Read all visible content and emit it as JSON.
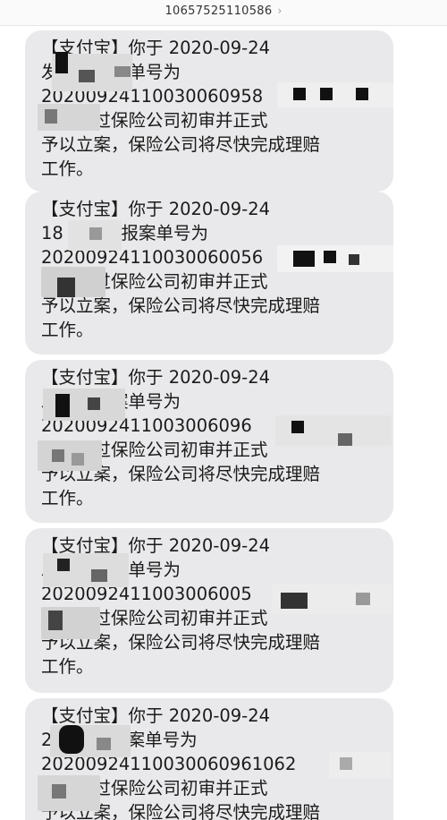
{
  "header": {
    "contact_number": "10657525110586",
    "chevron_icon": "chevron-right-icon"
  },
  "messages": [
    {
      "lines": [
        "【支付宝】你于 2020-09-24",
        "        发起的报案单号为",
        "20200924110030060958",
        "    案已通过保险公司初审并正式",
        "予以立案，保险公司将尽快完成理赔",
        "工作。"
      ]
    },
    {
      "lines": [
        "【支付宝】你于 2020-09-24",
        "18       发起的报案单号为",
        "20200924110030060056",
        "     案已通过保险公司初审并正式",
        "予以立案，保险公司将尽快完成理赔",
        "工作。"
      ]
    },
    {
      "lines": [
        "【支付宝】你于 2020-09-24",
        "        发起的报案单号为",
        "2020092411003006096",
        "     案已通过保险公司初审并正式",
        "予以立案，保险公司将尽快完成理赔",
        "工作。"
      ]
    },
    {
      "lines": [
        "【支付宝】你于 2020-09-24",
        "        发起的报案单号为",
        "2020092411003006005",
        "     案已通过保险公司初审并正式",
        "予以立案，保险公司将尽快完成理赔",
        "工作。"
      ]
    },
    {
      "lines": [
        "【支付宝】你于 2020-09-24",
        "2        发起的报案单号为",
        "20200924110030060961062",
        "     案已通过保险公司初审并正式",
        "予以立案，保险公司将尽快完成理赔"
      ]
    }
  ]
}
